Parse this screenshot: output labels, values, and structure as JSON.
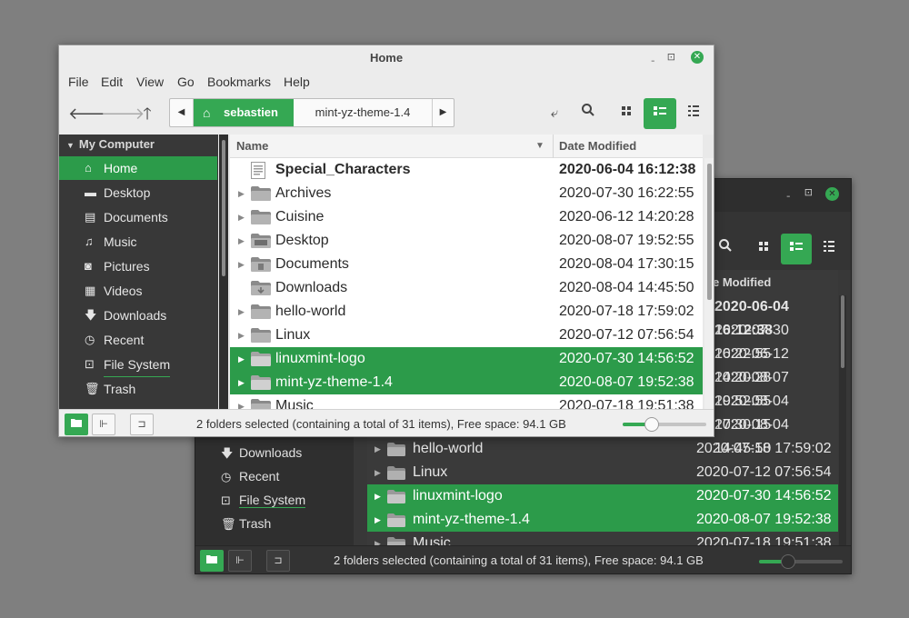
{
  "colors": {
    "accent": "#35a853",
    "selection": "#2c9b4a",
    "dark_bg": "#383838",
    "light_bg": "#e9e9e9"
  },
  "light_window": {
    "title": "Home",
    "menu": [
      "File",
      "Edit",
      "View",
      "Go",
      "Bookmarks",
      "Help"
    ],
    "path": {
      "home_label": "sebastien",
      "crumb": "mint-yz-theme-1.4"
    },
    "sidebar": {
      "header": "My Computer",
      "items": [
        {
          "label": "Home",
          "icon": "home-icon",
          "active": true
        },
        {
          "label": "Desktop",
          "icon": "desktop-icon"
        },
        {
          "label": "Documents",
          "icon": "documents-icon"
        },
        {
          "label": "Music",
          "icon": "music-icon"
        },
        {
          "label": "Pictures",
          "icon": "camera-icon"
        },
        {
          "label": "Videos",
          "icon": "film-icon"
        },
        {
          "label": "Downloads",
          "icon": "download-icon"
        },
        {
          "label": "Recent",
          "icon": "clock-icon"
        },
        {
          "label": "File System",
          "icon": "drive-icon"
        },
        {
          "label": "Trash",
          "icon": "trash-icon"
        }
      ]
    },
    "columns": {
      "name": "Name",
      "date": "Date Modified"
    },
    "files": [
      {
        "name": "Special_Characters",
        "date": "2020-06-04 16:12:38",
        "bold": true,
        "type": "file"
      },
      {
        "name": "Archives",
        "date": "2020-07-30 16:22:55",
        "type": "folder"
      },
      {
        "name": "Cuisine",
        "date": "2020-06-12 14:20:28",
        "type": "folder"
      },
      {
        "name": "Desktop",
        "date": "2020-08-07 19:52:55",
        "type": "folder"
      },
      {
        "name": "Documents",
        "date": "2020-08-04 17:30:15",
        "type": "folder"
      },
      {
        "name": "Downloads",
        "date": "2020-08-04 14:45:50",
        "type": "folder"
      },
      {
        "name": "hello-world",
        "date": "2020-07-18 17:59:02",
        "type": "folder"
      },
      {
        "name": "Linux",
        "date": "2020-07-12 07:56:54",
        "type": "folder"
      },
      {
        "name": "linuxmint-logo",
        "date": "2020-07-30 14:56:52",
        "selected": true,
        "type": "folder"
      },
      {
        "name": "mint-yz-theme-1.4",
        "date": "2020-08-07 19:52:38",
        "selected": true,
        "type": "folder"
      },
      {
        "name": "Music",
        "date": "2020-07-18 19:51:38",
        "type": "folder"
      }
    ],
    "status": "2 folders selected (containing a total of 31 items), Free space: 94.1 GB",
    "zoom_level": 0.35
  },
  "dark_window": {
    "column_date_partial": "e Modified",
    "sidebar_items": [
      {
        "label": "Downloads",
        "icon": "download-icon"
      },
      {
        "label": "Recent",
        "icon": "clock-icon"
      },
      {
        "label": "File System",
        "icon": "drive-icon"
      },
      {
        "label": "Trash",
        "icon": "trash-icon"
      }
    ],
    "dates_top": [
      "2020-06-04 16:12:38",
      "2020-07-30 16:22:55",
      "2020-06-12 14:20:28",
      "2020-08-07 19:52:55",
      "2020-08-04 17:30:15",
      "2020-08-04 14:45:50"
    ],
    "files": [
      {
        "name": "hello-world",
        "date": "2020-07-18 17:59:02"
      },
      {
        "name": "Linux",
        "date": "2020-07-12 07:56:54"
      },
      {
        "name": "linuxmint-logo",
        "date": "2020-07-30 14:56:52",
        "selected": true
      },
      {
        "name": "mint-yz-theme-1.4",
        "date": "2020-08-07 19:52:38",
        "selected": true
      },
      {
        "name": "Music",
        "date": "2020-07-18 19:51:38"
      }
    ],
    "status": "2 folders selected (containing a total of 31 items), Free space: 94.1 GB",
    "zoom_level": 0.35
  }
}
